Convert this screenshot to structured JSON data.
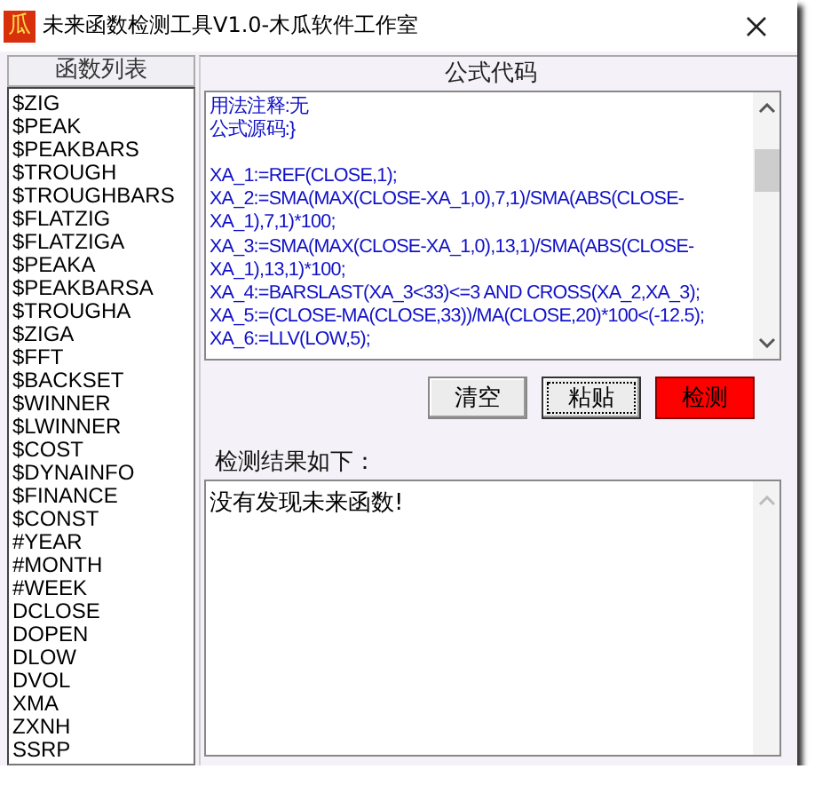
{
  "window": {
    "icon_text": "瓜",
    "title": "未来函数检测工具V1.0-木瓜软件工作室"
  },
  "function_list": {
    "header": "函数列表",
    "items": [
      "$ZIG",
      "$PEAK",
      "$PEAKBARS",
      "$TROUGH",
      "$TROUGHBARS",
      "$FLATZIG",
      "$FLATZIGA",
      "$PEAKA",
      "$PEAKBARSA",
      "$TROUGHA",
      "$ZIGA",
      "$FFT",
      "$BACKSET",
      "$WINNER",
      "$LWINNER",
      "$COST",
      "$DYNAINFO",
      "$FINANCE",
      "$CONST",
      "#YEAR",
      "#MONTH",
      "#WEEK",
      "DCLOSE",
      "DOPEN",
      "DLOW",
      "DVOL",
      "XMA",
      "ZXNH",
      "SSRP"
    ]
  },
  "code_panel": {
    "header": "公式代码",
    "blocks": [
      [
        "用法注释:无",
        "公式源码:}"
      ],
      [
        "XA_1:=REF(CLOSE,1);",
        "XA_2:=SMA(MAX(CLOSE-XA_1,0),7,1)/SMA(ABS(CLOSE-",
        "XA_1),7,1)*100;",
        "XA_3:=SMA(MAX(CLOSE-XA_1,0),13,1)/SMA(ABS(CLOSE-",
        "XA_1),13,1)*100;",
        "XA_4:=BARSLAST(XA_3<33)<=3 AND CROSS(XA_2,XA_3);",
        "XA_5:=(CLOSE-MA(CLOSE,33))/MA(CLOSE,20)*100<(-12.5);",
        "XA_6:=LLV(LOW,5);"
      ]
    ]
  },
  "buttons": [
    {
      "label": "清空",
      "kind": "normal",
      "focused": false
    },
    {
      "label": "粘贴",
      "kind": "normal",
      "focused": true
    },
    {
      "label": "检测",
      "kind": "alert",
      "focused": false
    }
  ],
  "result": {
    "label": "检测结果如下：",
    "value": "没有发现未来函数!"
  }
}
